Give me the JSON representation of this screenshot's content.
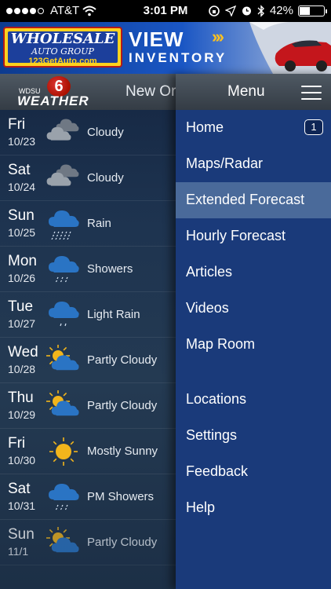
{
  "status_bar": {
    "carrier": "AT&T",
    "time": "3:01 PM",
    "battery": "42%",
    "battery_level": 0.42,
    "signal_bars_filled": 4,
    "signal_bars_total": 5
  },
  "ad": {
    "logo_line1": "WHOLESALE",
    "logo_line2": "AUTO GROUP",
    "logo_line3": "123GetAuto.com",
    "cta_line1": "VIEW",
    "cta_line2": "INVENTORY",
    "arrows": "›››"
  },
  "app_header": {
    "logo_small": "WDSU",
    "logo_big": "WEATHER",
    "logo_number": "6",
    "location": "New Or"
  },
  "forecast": [
    {
      "day": "Fri",
      "date": "10/23",
      "condition": "Cloudy",
      "icon": "cloudy-icon"
    },
    {
      "day": "Sat",
      "date": "10/24",
      "condition": "Cloudy",
      "icon": "cloudy-icon"
    },
    {
      "day": "Sun",
      "date": "10/25",
      "condition": "Rain",
      "icon": "rain-icon"
    },
    {
      "day": "Mon",
      "date": "10/26",
      "condition": "Showers",
      "icon": "showers-icon"
    },
    {
      "day": "Tue",
      "date": "10/27",
      "condition": "Light Rain",
      "icon": "light-rain-icon"
    },
    {
      "day": "Wed",
      "date": "10/28",
      "condition": "Partly Cloudy",
      "icon": "partly-cloudy-icon"
    },
    {
      "day": "Thu",
      "date": "10/29",
      "condition": "Partly Cloudy",
      "icon": "partly-cloudy-icon"
    },
    {
      "day": "Fri",
      "date": "10/30",
      "condition": "Mostly Sunny",
      "icon": "sunny-icon"
    },
    {
      "day": "Sat",
      "date": "10/31",
      "condition": "PM Showers",
      "icon": "showers-icon"
    },
    {
      "day": "Sun",
      "date": "11/1",
      "condition": "Partly Cloudy",
      "icon": "partly-cloudy-icon"
    }
  ],
  "menu": {
    "title": "Menu",
    "items": [
      {
        "label": "Home",
        "badge": "1"
      },
      {
        "label": "Maps/Radar"
      },
      {
        "label": "Extended Forecast",
        "active": true
      },
      {
        "label": "Hourly Forecast"
      },
      {
        "label": "Articles"
      },
      {
        "label": "Videos"
      },
      {
        "label": "Map Room"
      },
      {
        "label": "Locations"
      },
      {
        "label": "Settings"
      },
      {
        "label": "Feedback"
      },
      {
        "label": "Help"
      }
    ]
  },
  "colors": {
    "menu_bg": "#1a3a7a",
    "menu_active_bg": "#4a6a9a",
    "ad_yellow": "#ffd21e",
    "sun": "#f2b51c",
    "rain_cloud": "#2a74c4"
  }
}
